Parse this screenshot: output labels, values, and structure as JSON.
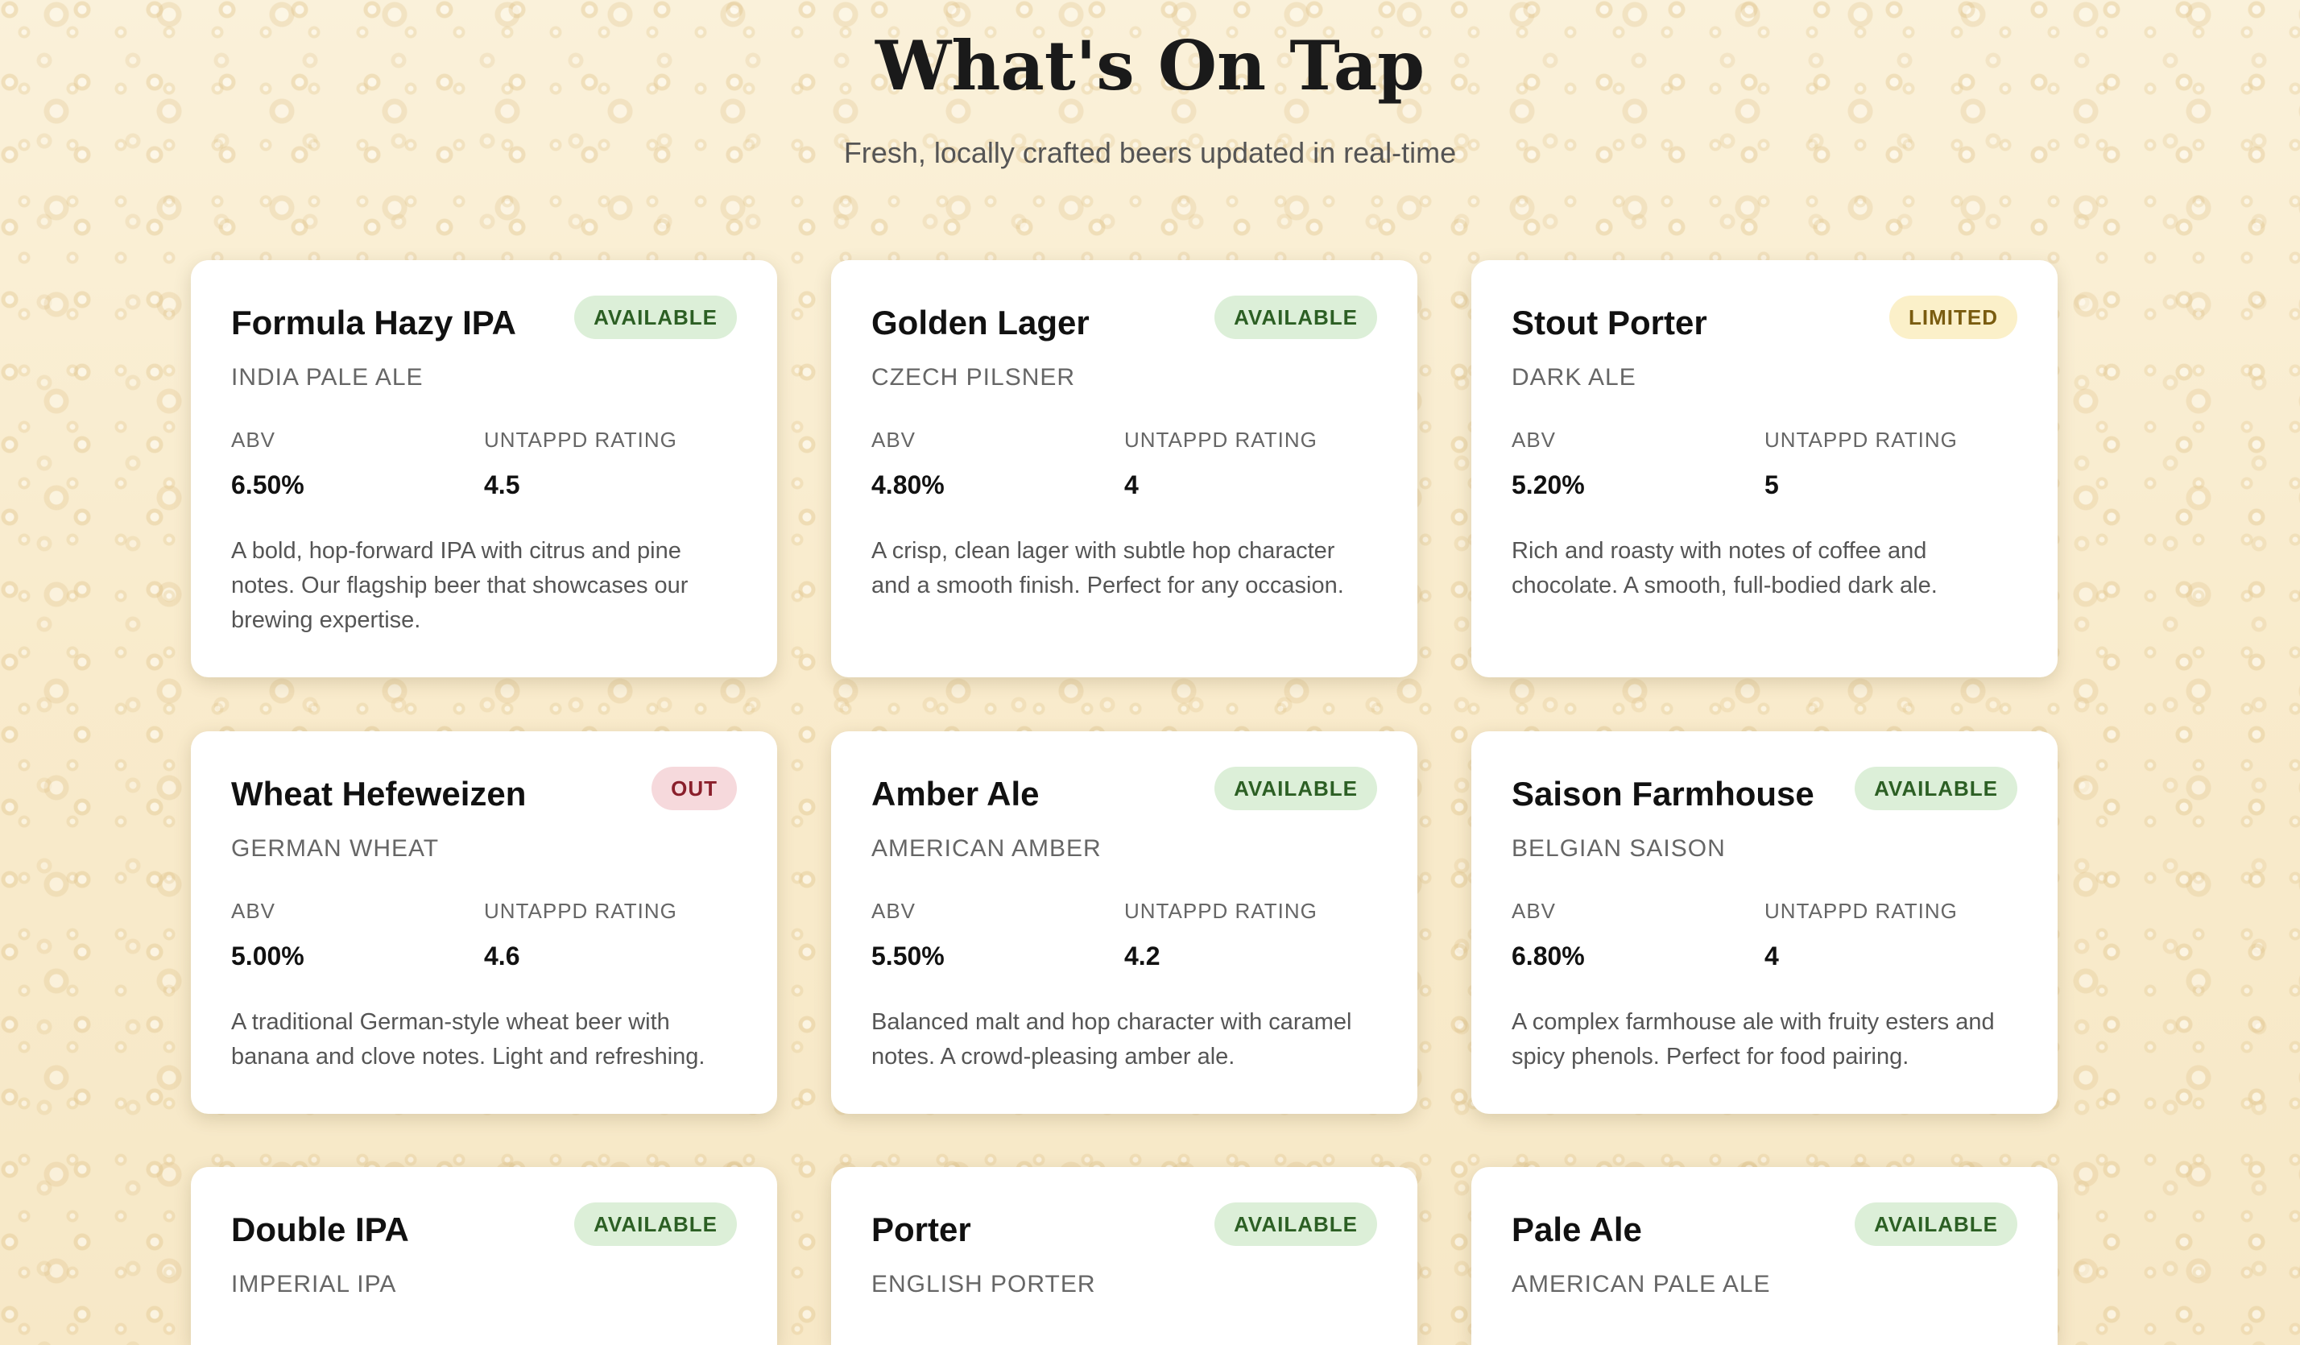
{
  "header": {
    "title": "What's On Tap",
    "subtitle": "Fresh, locally crafted beers updated in real-time"
  },
  "labels": {
    "abv": "ABV",
    "rating": "UNTAPPD RATING"
  },
  "beers": [
    {
      "name": "Formula Hazy IPA",
      "status": "AVAILABLE",
      "style": "INDIA PALE ALE",
      "abv": "6.50%",
      "rating": "4.5",
      "description": "A bold, hop-forward IPA with citrus and pine notes. Our flagship beer that showcases our brewing expertise."
    },
    {
      "name": "Golden Lager",
      "status": "AVAILABLE",
      "style": "CZECH PILSNER",
      "abv": "4.80%",
      "rating": "4",
      "description": "A crisp, clean lager with subtle hop character and a smooth finish. Perfect for any occasion."
    },
    {
      "name": "Stout Porter",
      "status": "LIMITED",
      "style": "DARK ALE",
      "abv": "5.20%",
      "rating": "5",
      "description": "Rich and roasty with notes of coffee and chocolate. A smooth, full-bodied dark ale."
    },
    {
      "name": "Wheat Hefeweizen",
      "status": "OUT",
      "style": "GERMAN WHEAT",
      "abv": "5.00%",
      "rating": "4.6",
      "description": "A traditional German-style wheat beer with banana and clove notes. Light and refreshing."
    },
    {
      "name": "Amber Ale",
      "status": "AVAILABLE",
      "style": "AMERICAN AMBER",
      "abv": "5.50%",
      "rating": "4.2",
      "description": "Balanced malt and hop character with caramel notes. A crowd-pleasing amber ale."
    },
    {
      "name": "Saison Farmhouse",
      "status": "AVAILABLE",
      "style": "BELGIAN SAISON",
      "abv": "6.80%",
      "rating": "4",
      "description": "A complex farmhouse ale with fruity esters and spicy phenols. Perfect for food pairing."
    },
    {
      "name": "Double IPA",
      "status": "AVAILABLE",
      "style": "IMPERIAL IPA",
      "abv": "",
      "rating": "",
      "description": ""
    },
    {
      "name": "Porter",
      "status": "AVAILABLE",
      "style": "ENGLISH PORTER",
      "abv": "",
      "rating": "",
      "description": ""
    },
    {
      "name": "Pale Ale",
      "status": "AVAILABLE",
      "style": "AMERICAN PALE ALE",
      "abv": "",
      "rating": "",
      "description": ""
    }
  ],
  "colors": {
    "available_bg": "#dcefd8",
    "available_text": "#2c5f24",
    "limited_bg": "#fbf0c9",
    "limited_text": "#7a5c10",
    "out_bg": "#f6d9dc",
    "out_text": "#8a1f2b"
  }
}
